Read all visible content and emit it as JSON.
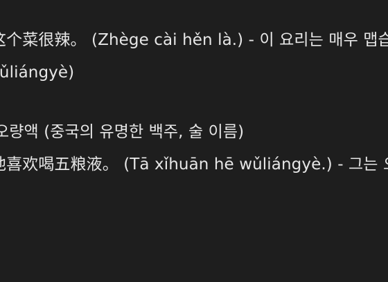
{
  "content": {
    "lines": [
      {
        "text": "这个菜很辣。 (Zhège cài hěn là.) - 이 요리는 매우 맵습니다."
      },
      {
        "text": "wǔliángyè)"
      },
      {
        "text": "오량액 (중국의 유명한 백주, 술 이름)"
      },
      {
        "text": "他喜欢喝五粮液。 (Tā xǐhuān hē wǔliángyè.) - 그는 오량액 마시는 것을 좋아합니다."
      }
    ]
  }
}
